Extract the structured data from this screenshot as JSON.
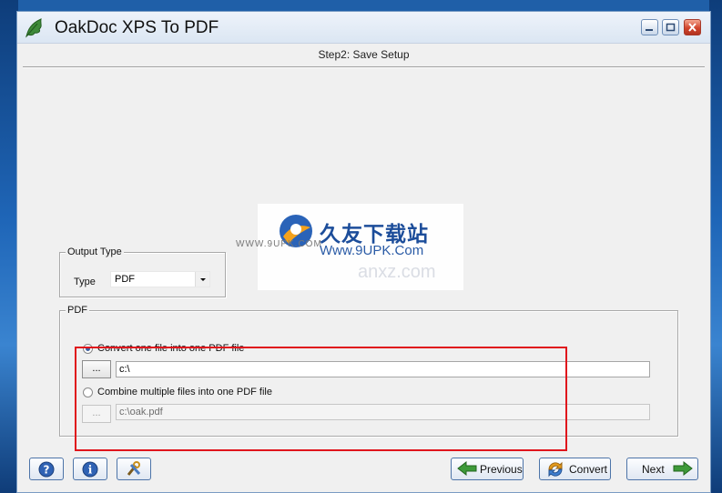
{
  "window": {
    "title": "OakDoc XPS To PDF",
    "step_title": "Step2: Save Setup"
  },
  "output_type": {
    "legend": "Output Type",
    "type_label": "Type",
    "type_value": "PDF"
  },
  "pdf": {
    "legend": "PDF",
    "option_single": "Convert one file into one PDF file",
    "option_single_selected": true,
    "single_browse": "...",
    "single_path": "c:\\",
    "option_multi": "Combine multiple files into one PDF file",
    "option_multi_selected": false,
    "multi_browse": "...",
    "multi_path": "c:\\oak.pdf"
  },
  "watermark": {
    "small": "WWW.9UPK.COM",
    "cn": "久友下载站",
    "url": "Www.9UPK.Com",
    "faint": "anxz.com"
  },
  "footer": {
    "previous": "Previous",
    "convert": "Convert",
    "next": "Next"
  },
  "icons": {
    "app": "oak-leaf-icon",
    "help": "help-icon",
    "info": "info-icon",
    "tools": "tools-icon",
    "previous": "arrow-left-icon",
    "convert": "convert-cycle-icon",
    "next": "arrow-right-icon"
  },
  "colors": {
    "highlight": "#e0151c",
    "accent": "#3c5f9e"
  }
}
